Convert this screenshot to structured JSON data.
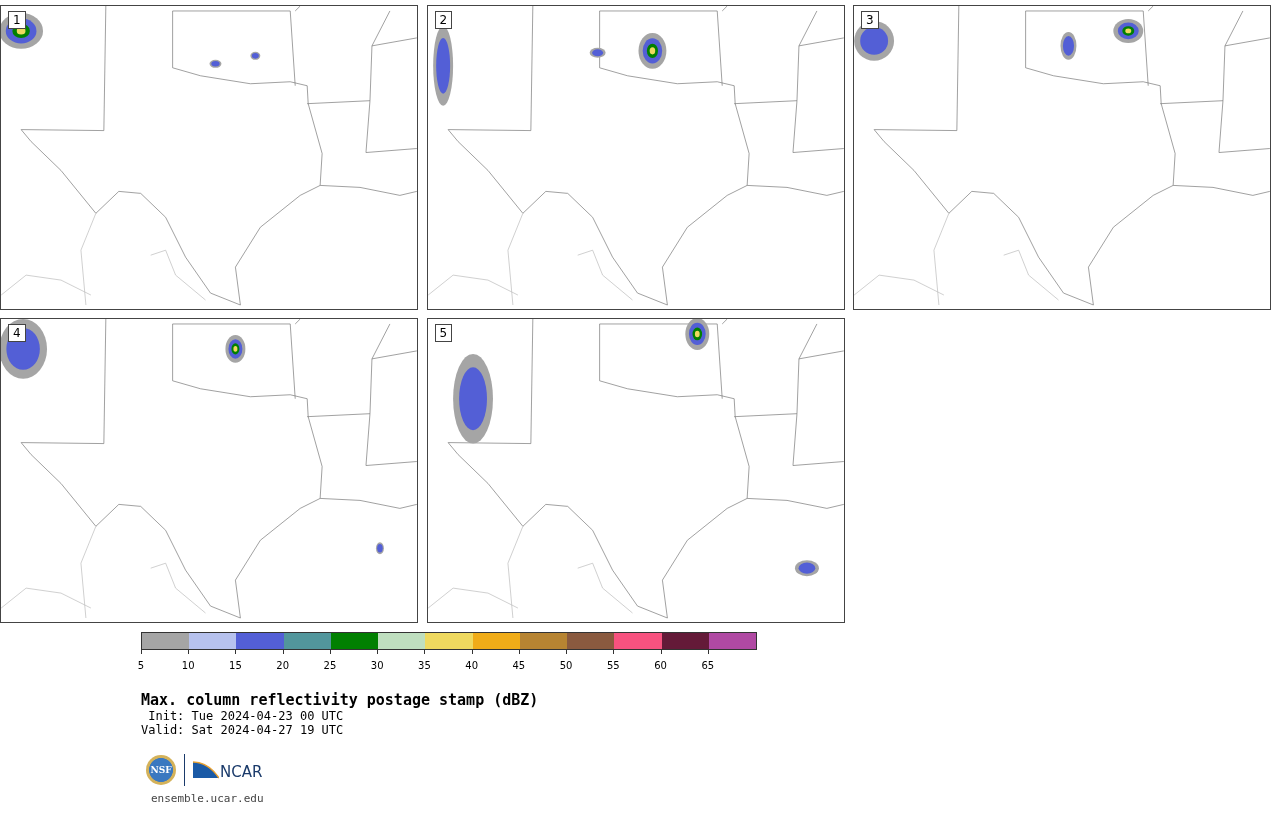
{
  "panels": [
    {
      "label": "1"
    },
    {
      "label": "2"
    },
    {
      "label": "3"
    },
    {
      "label": "4"
    },
    {
      "label": "5"
    }
  ],
  "colorbar": {
    "bins": [
      {
        "label": "5",
        "color": "#a5a5a5"
      },
      {
        "label": "10",
        "color": "#b7c2ee"
      },
      {
        "label": "15",
        "color": "#535fd6"
      },
      {
        "label": "20",
        "color": "#52969c"
      },
      {
        "label": "25",
        "color": "#018001"
      },
      {
        "label": "30",
        "color": "#bfdfbf"
      },
      {
        "label": "35",
        "color": "#efd95f"
      },
      {
        "label": "40",
        "color": "#f0ac18"
      },
      {
        "label": "45",
        "color": "#b78432"
      },
      {
        "label": "50",
        "color": "#8a5a3f"
      },
      {
        "label": "55",
        "color": "#f7527f"
      },
      {
        "label": "60",
        "color": "#641a38"
      },
      {
        "label": "65",
        "color": "#b049a3"
      }
    ]
  },
  "title": "Max. column reflectivity postage stamp (dBZ)",
  "init": " Init: Tue 2024-04-23 00 UTC",
  "valid": "Valid: Sat 2024-04-27 19 UTC",
  "logos": {
    "seal_text": "NSF",
    "wordmark": "NCAR"
  },
  "footer_link": "ensemble.ucar.edu"
}
